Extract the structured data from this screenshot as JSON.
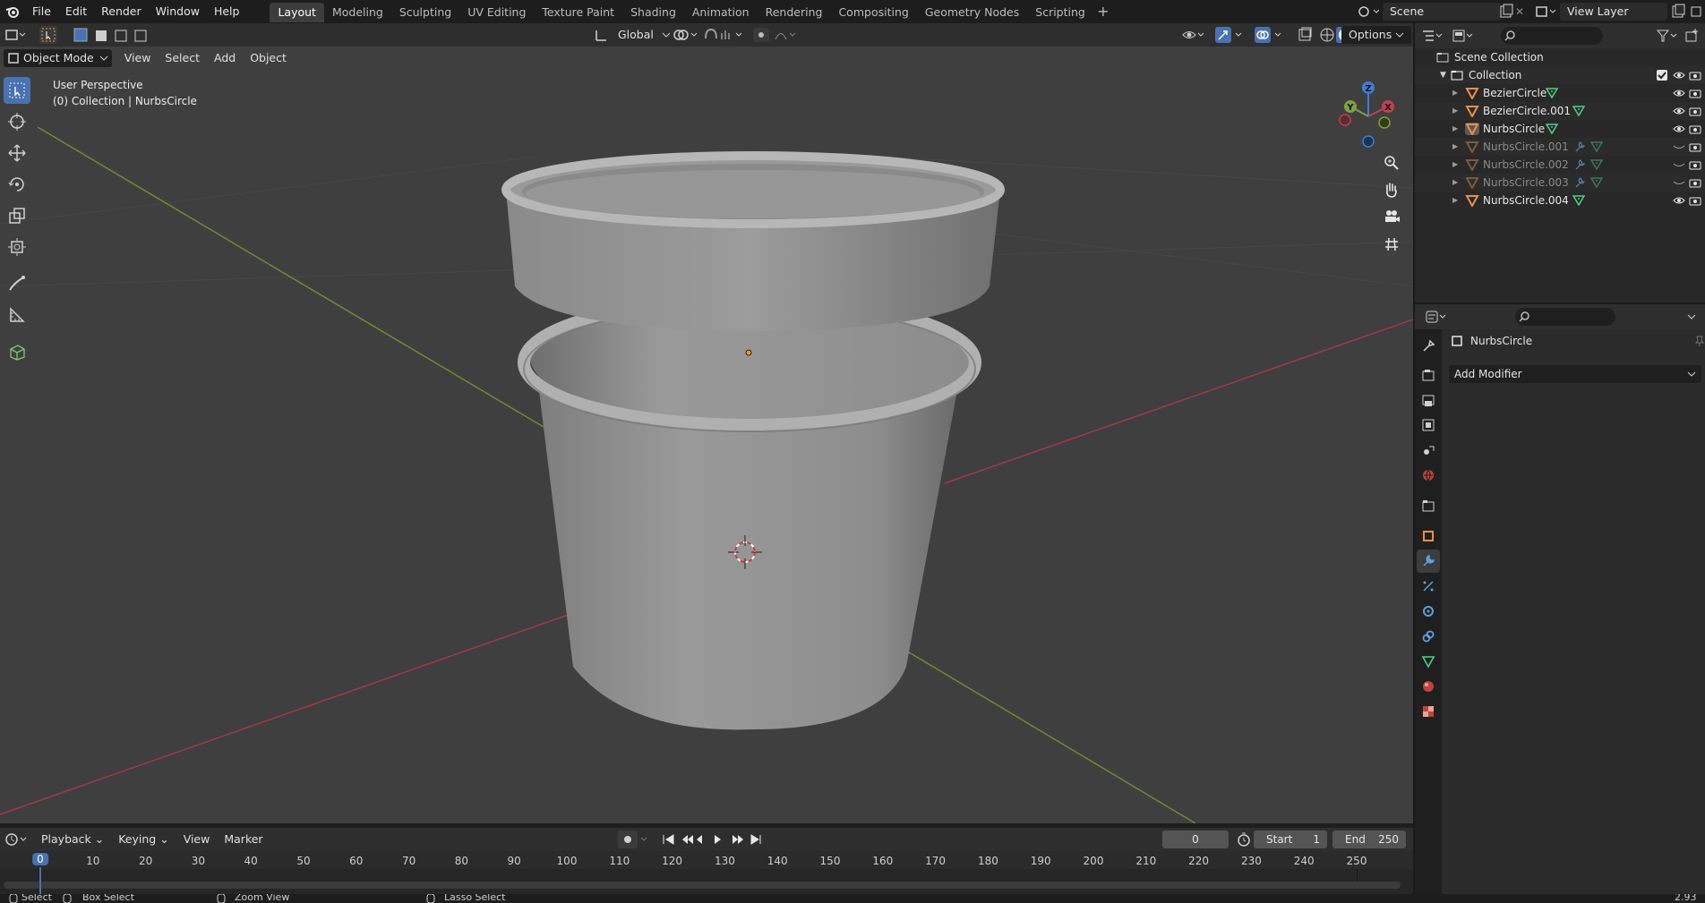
{
  "menubar": {
    "items": [
      "File",
      "Edit",
      "Render",
      "Window",
      "Help"
    ],
    "workspaces": [
      "Layout",
      "Modeling",
      "Sculpting",
      "UV Editing",
      "Texture Paint",
      "Shading",
      "Animation",
      "Rendering",
      "Compositing",
      "Geometry Nodes",
      "Scripting"
    ],
    "active_workspace": "Layout",
    "scene": "Scene",
    "view_layer": "View Layer"
  },
  "viewport_header": {
    "mode": "Object Mode",
    "menus": [
      "View",
      "Select",
      "Add",
      "Object"
    ],
    "transform_orientation": "Global",
    "options_label": "Options"
  },
  "viewport": {
    "perspective_label": "User Perspective",
    "collection_label": "(0) Collection | NurbsCircle",
    "gizmo": {
      "x": "X",
      "y": "Y",
      "z": "Z"
    }
  },
  "outliner": {
    "scene_collection": "Scene Collection",
    "collection": "Collection",
    "objects": [
      {
        "name": "BezierCircle",
        "enabled": true,
        "modifier": false
      },
      {
        "name": "BezierCircle.001",
        "enabled": true,
        "modifier": false
      },
      {
        "name": "NurbsCircle",
        "enabled": true,
        "modifier": false,
        "active": true
      },
      {
        "name": "NurbsCircle.001",
        "enabled": false,
        "modifier": true
      },
      {
        "name": "NurbsCircle.002",
        "enabled": false,
        "modifier": true
      },
      {
        "name": "NurbsCircle.003",
        "enabled": false,
        "modifier": true
      },
      {
        "name": "NurbsCircle.004",
        "enabled": true,
        "modifier": false
      }
    ]
  },
  "properties": {
    "object_name": "NurbsCircle",
    "add_modifier_label": "Add Modifier"
  },
  "timeline": {
    "menus": [
      "Playback",
      "Keying",
      "View",
      "Marker"
    ],
    "current_frame": "0",
    "start_label": "Start",
    "start_value": "1",
    "end_label": "End",
    "end_value": "250",
    "ticks": [
      "0",
      "10",
      "20",
      "30",
      "40",
      "50",
      "60",
      "70",
      "80",
      "90",
      "100",
      "110",
      "120",
      "130",
      "140",
      "150",
      "160",
      "170",
      "180",
      "190",
      "200",
      "210",
      "220",
      "230",
      "240",
      "250"
    ]
  },
  "statusbar": {
    "select": "Select",
    "box_select": "Box Select",
    "zoom_view": "Zoom View",
    "lasso_select": "Lasso Select",
    "version": "2.93"
  },
  "colors": {
    "accent": "#4772b3",
    "x_axis": "#c0404f",
    "y_axis": "#7ea33a",
    "z_axis": "#3b7ed6",
    "object_orange": "#e8904a"
  }
}
